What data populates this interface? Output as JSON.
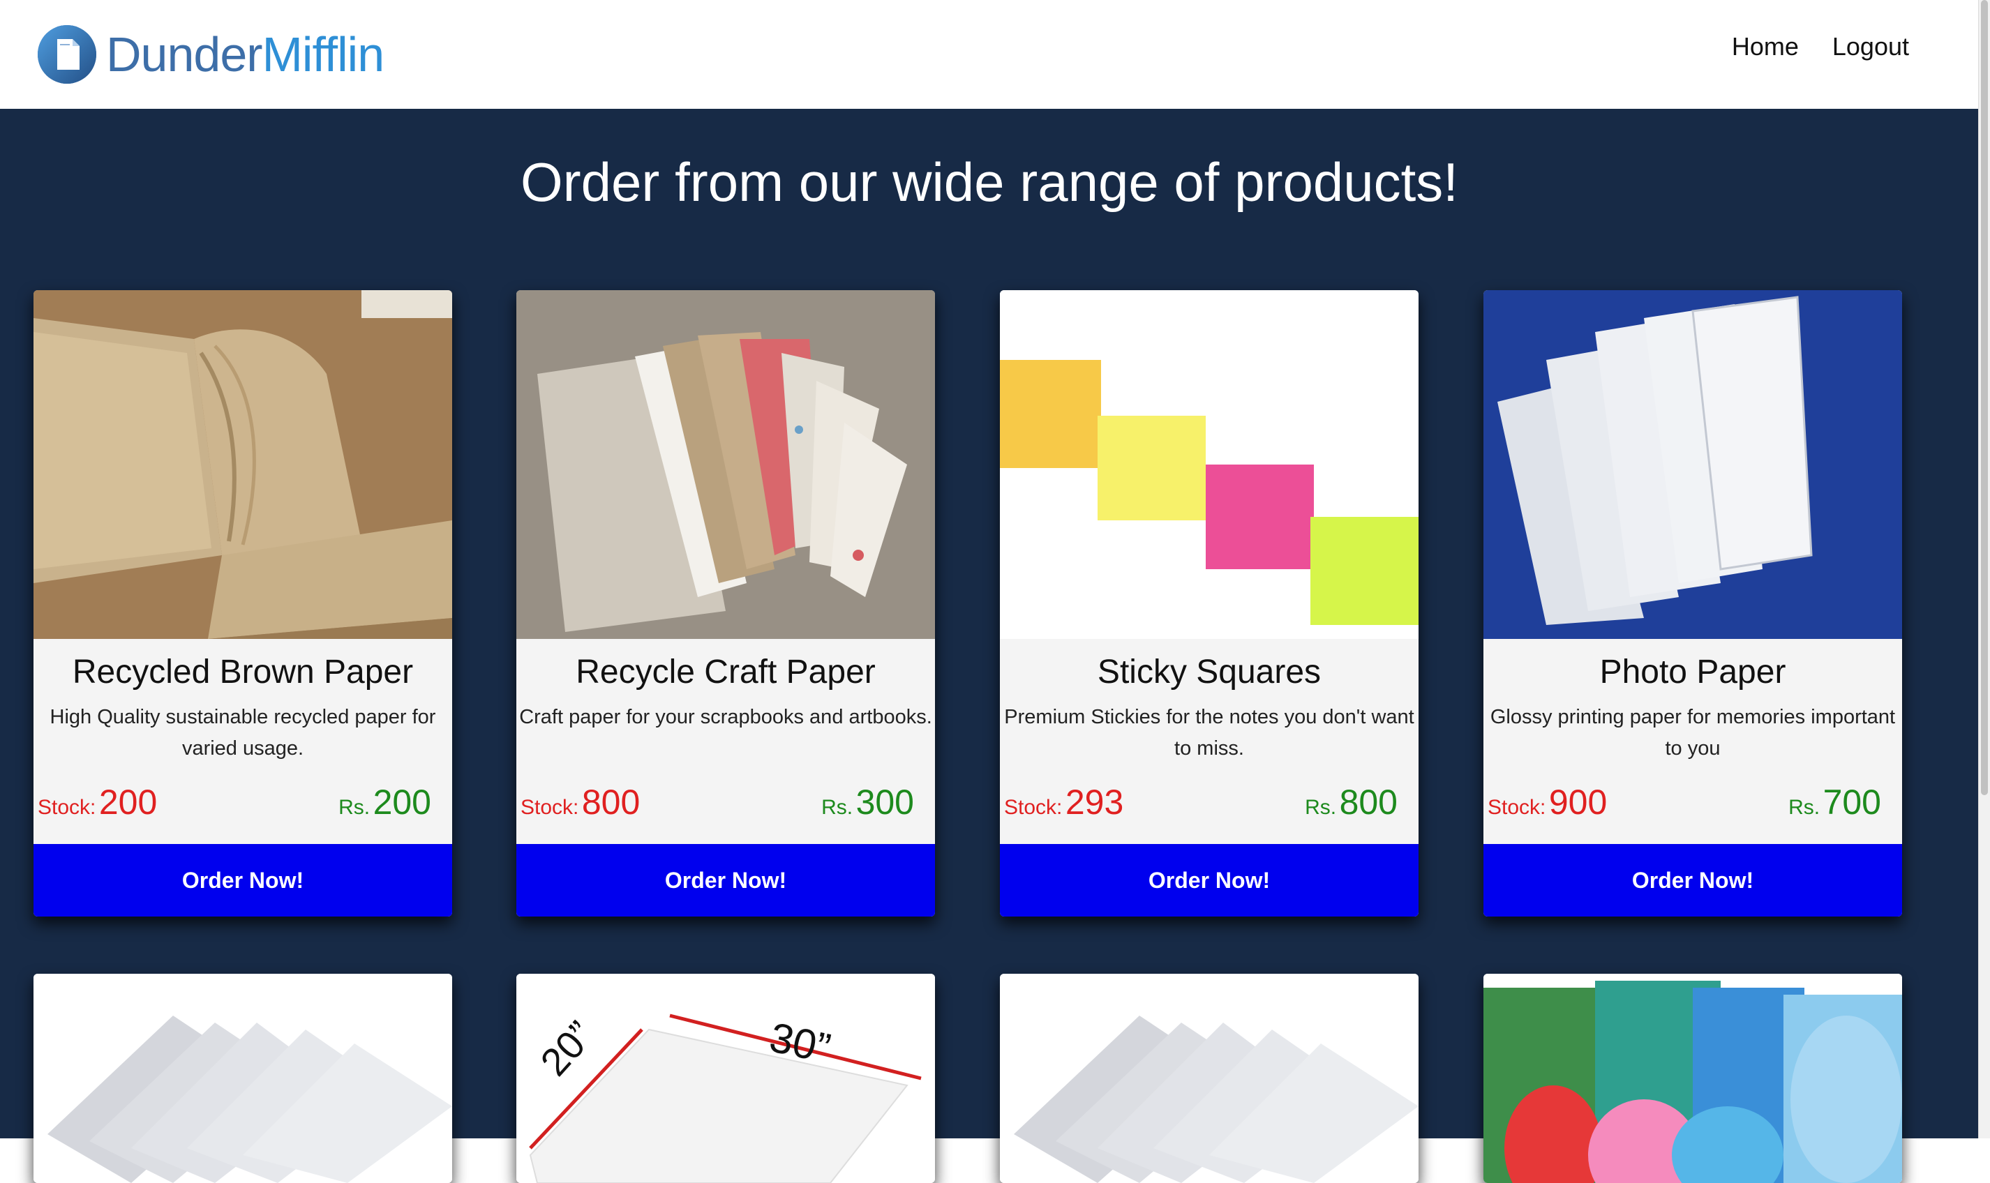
{
  "header": {
    "brand_part1": "Dunder",
    "brand_part2": "Mifflin",
    "nav": {
      "home": "Home",
      "logout": "Logout"
    }
  },
  "main": {
    "title": "Order from our wide range of products!"
  },
  "products": [
    {
      "name": "Recycled Brown Paper",
      "description": "High Quality sustainable recycled paper for varied usage.",
      "stock_label": "Stock:",
      "stock": "200",
      "price_label": "Rs.",
      "price": "200",
      "button": "Order Now!",
      "image": "brown-paper-notebook-image"
    },
    {
      "name": "Recycle Craft Paper",
      "description": "Craft paper for your scrapbooks and artbooks.",
      "stock_label": "Stock:",
      "stock": "800",
      "price_label": "Rs.",
      "price": "300",
      "button": "Order Now!",
      "image": "handmade-craft-paper-fan-image"
    },
    {
      "name": "Sticky Squares",
      "description": "Premium Stickies for the notes you don't want to miss.",
      "stock_label": "Stock:",
      "stock": "293",
      "price_label": "Rs.",
      "price": "800",
      "button": "Order Now!",
      "image": "sticky-notes-image"
    },
    {
      "name": "Photo Paper",
      "description": "Glossy printing paper for memories important to you",
      "stock_label": "Stock:",
      "stock": "900",
      "price_label": "Rs.",
      "price": "700",
      "button": "Order Now!",
      "image": "photo-paper-packs-image"
    }
  ],
  "second_row_images": [
    {
      "image": "white-paper-fan-image"
    },
    {
      "image": "paper-size-diagram-image",
      "label_a": "20”",
      "label_b": "30”"
    },
    {
      "image": "white-paper-fan-image"
    },
    {
      "image": "crepe-paper-rolls-image"
    }
  ],
  "colors": {
    "page_bg": "#172a46",
    "button_bg": "#0000ee",
    "stock_color": "#e02020",
    "price_color": "#1d8a1d",
    "brand_dark": "#3d6ea8",
    "brand_light": "#2e8fd6"
  }
}
